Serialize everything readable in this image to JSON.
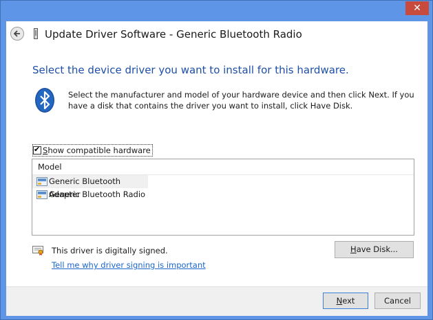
{
  "window": {
    "close_glyph": "✕",
    "title": "Update Driver Software - Generic Bluetooth Radio"
  },
  "page": {
    "heading": "Select the device driver you want to install for this hardware.",
    "description": "Select the manufacturer and model of your hardware device and then click Next. If you have a disk that contains the driver you want to install, click Have Disk."
  },
  "compatible": {
    "label_underlined": "S",
    "label_rest": "how compatible hardware",
    "checked": true
  },
  "model_list": {
    "header": "Model",
    "items": [
      {
        "label": "Generic Bluetooth Adapter",
        "selected": true
      },
      {
        "label": "Generic Bluetooth Radio",
        "selected": false
      }
    ]
  },
  "signing": {
    "status_text": "This driver is digitally signed.",
    "link_text": "Tell me why driver signing is important"
  },
  "buttons": {
    "have_disk_underlined": "H",
    "have_disk_rest": "ave Disk...",
    "next_underlined": "N",
    "next_rest": "ext",
    "cancel": "Cancel"
  },
  "colors": {
    "window_frame": "#5e95e6",
    "heading": "#1d4fa8",
    "link": "#1a66cc",
    "close_button": "#c74a3c"
  },
  "icons": [
    "back-arrow-icon",
    "device-icon",
    "bluetooth-icon",
    "driver-icon",
    "signed-driver-icon",
    "close-icon"
  ]
}
